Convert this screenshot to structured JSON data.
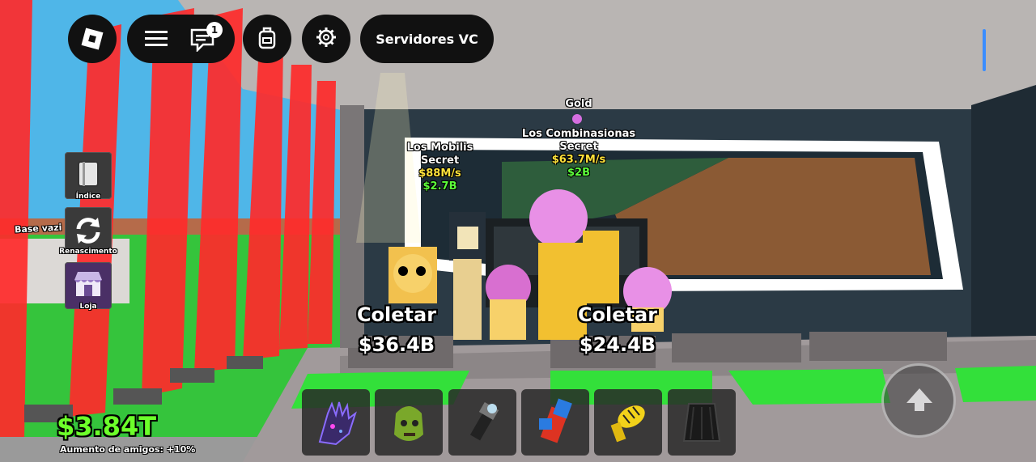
{
  "topbar": {
    "vc_button_label": "Servidores VC",
    "chat_badge_count": "1",
    "icons": [
      "roblox-logo-icon",
      "menu-icon",
      "chat-icon",
      "backpack-icon",
      "gear-icon"
    ]
  },
  "side_menu": {
    "items": [
      {
        "label": "Índice",
        "icon": "book-icon"
      },
      {
        "label": "Renascimento",
        "icon": "refresh-icon"
      },
      {
        "label": "Loja",
        "icon": "shop-icon"
      }
    ]
  },
  "world": {
    "base_sign": "Base vazi"
  },
  "brainrots": [
    {
      "rarity": "",
      "name": "Los Mobilis",
      "tier": "Secret",
      "rate": "$88M/s",
      "price": "$2.7B"
    },
    {
      "rarity": "Gold",
      "name": "Los Combinasionas",
      "tier": "Secret",
      "rate": "$63.7M/s",
      "price": "$2B"
    }
  ],
  "collect": [
    {
      "label": "Coletar",
      "amount": "$36.4B"
    },
    {
      "label": "Coletar",
      "amount": "$24.4B"
    }
  ],
  "hud": {
    "money": "$3.84T",
    "friend_boost": "Aumento de amigos: +10%"
  },
  "hotbar": {
    "items": [
      "galaxy-glove-icon",
      "zombie-head-icon",
      "flashlight-icon",
      "block-tool-icon",
      "rocket-launcher-icon",
      "cape-icon"
    ]
  },
  "colors": {
    "money_green": "#6cff2a",
    "rate_yellow": "#ffe23a",
    "price_green": "#5cff3a",
    "barrier_red": "#ff2b2b",
    "floor_green": "#33e03a"
  }
}
